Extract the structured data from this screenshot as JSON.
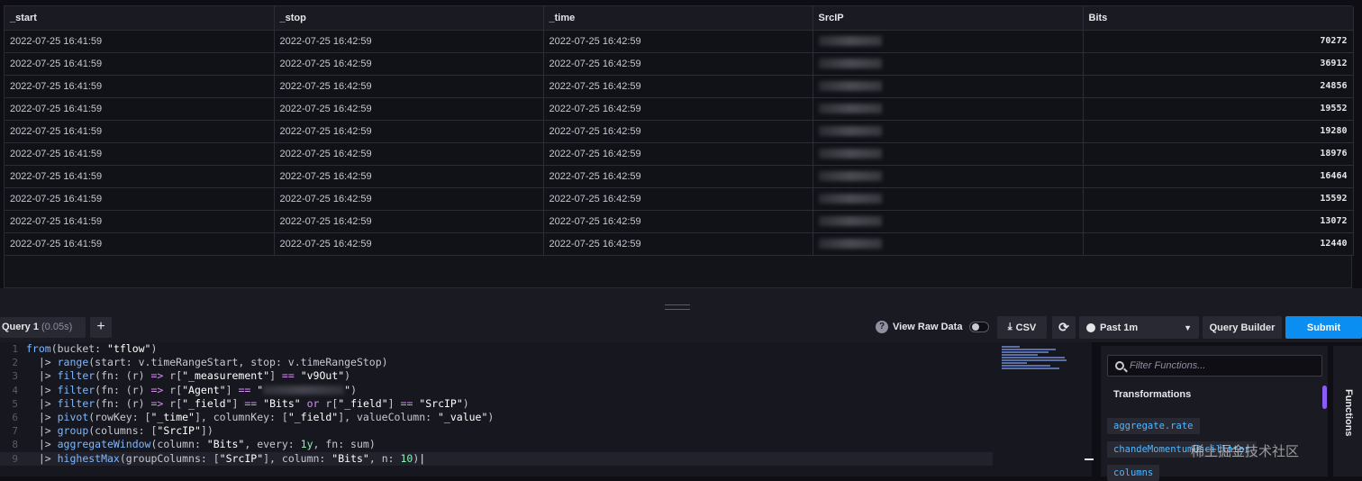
{
  "table": {
    "columns": [
      "_start",
      "_stop",
      "_time",
      "SrcIP",
      "Bits"
    ],
    "rows": [
      {
        "start": "2022-07-25 16:41:59",
        "stop": "2022-07-25 16:42:59",
        "time": "2022-07-25 16:42:59",
        "bits": "70272"
      },
      {
        "start": "2022-07-25 16:41:59",
        "stop": "2022-07-25 16:42:59",
        "time": "2022-07-25 16:42:59",
        "bits": "36912"
      },
      {
        "start": "2022-07-25 16:41:59",
        "stop": "2022-07-25 16:42:59",
        "time": "2022-07-25 16:42:59",
        "bits": "24856"
      },
      {
        "start": "2022-07-25 16:41:59",
        "stop": "2022-07-25 16:42:59",
        "time": "2022-07-25 16:42:59",
        "bits": "19552"
      },
      {
        "start": "2022-07-25 16:41:59",
        "stop": "2022-07-25 16:42:59",
        "time": "2022-07-25 16:42:59",
        "bits": "19280"
      },
      {
        "start": "2022-07-25 16:41:59",
        "stop": "2022-07-25 16:42:59",
        "time": "2022-07-25 16:42:59",
        "bits": "18976"
      },
      {
        "start": "2022-07-25 16:41:59",
        "stop": "2022-07-25 16:42:59",
        "time": "2022-07-25 16:42:59",
        "bits": "16464"
      },
      {
        "start": "2022-07-25 16:41:59",
        "stop": "2022-07-25 16:42:59",
        "time": "2022-07-25 16:42:59",
        "bits": "15592"
      },
      {
        "start": "2022-07-25 16:41:59",
        "stop": "2022-07-25 16:42:59",
        "time": "2022-07-25 16:42:59",
        "bits": "13072"
      },
      {
        "start": "2022-07-25 16:41:59",
        "stop": "2022-07-25 16:42:59",
        "time": "2022-07-25 16:42:59",
        "bits": "12440"
      }
    ]
  },
  "toolbar": {
    "query_tab": "Query 1",
    "query_time": "(0.05s)",
    "add_query": "+",
    "raw_data_label": "View Raw Data",
    "raw_data_on": false,
    "csv_label": "CSV",
    "time_range": "Past 1m",
    "query_builder_label": "Query Builder",
    "submit_label": "Submit",
    "submit_color": "#0b8ef1"
  },
  "editor": {
    "lines": [
      "from(bucket: \"tflow\")",
      "  |> range(start: v.timeRangeStart, stop: v.timeRangeStop)",
      "  |> filter(fn: (r) => r[\"_measurement\"] == \"v9Out\")",
      "  |> filter(fn: (r) => r[\"Agent\"] == \"",
      "  |> filter(fn: (r) => r[\"_field\"] == \"Bits\" or r[\"_field\"] == \"SrcIP\")",
      "  |> pivot(rowKey: [\"_time\"], columnKey: [\"_field\"], valueColumn: \"_value\")",
      "  |> group(columns: [\"SrcIP\"])",
      "  |> aggregateWindow(column: \"Bits\", every: 1y, fn: sum)",
      "  |> highestMax(groupColumns: [\"SrcIP\"], column: \"Bits\", n: 10)"
    ],
    "line4_tail": "\")",
    "active_line": 9
  },
  "functions": {
    "search_placeholder": "Filter Functions...",
    "group_title": "Transformations",
    "items": [
      "aggregate.rate",
      "chandeMomentumOscillator",
      "columns"
    ],
    "tab_label": "Functions"
  },
  "watermark": "稀土掘金技术社区"
}
